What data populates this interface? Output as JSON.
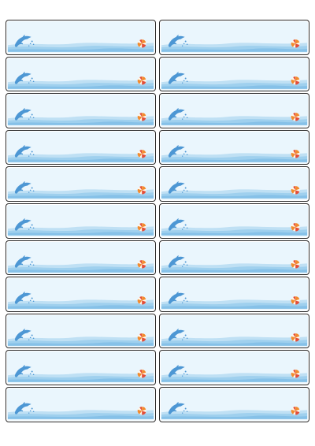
{
  "sheet": {
    "background_color": "#ffffff",
    "label_rows": 11,
    "label_columns": 2,
    "label_design": {
      "sky_color": "#eaf6fd",
      "wave_light_color": "#bfe0f4",
      "wave_mid_color": "#9fd0ee",
      "wave_dark_color": "#86c1e8",
      "dolphin_color": "#4d97d4",
      "ball_orange_color": "#f28b2e",
      "ball_red_color": "#e34e3a",
      "icons": [
        "dolphin-icon",
        "beach-ball-icon"
      ]
    }
  }
}
